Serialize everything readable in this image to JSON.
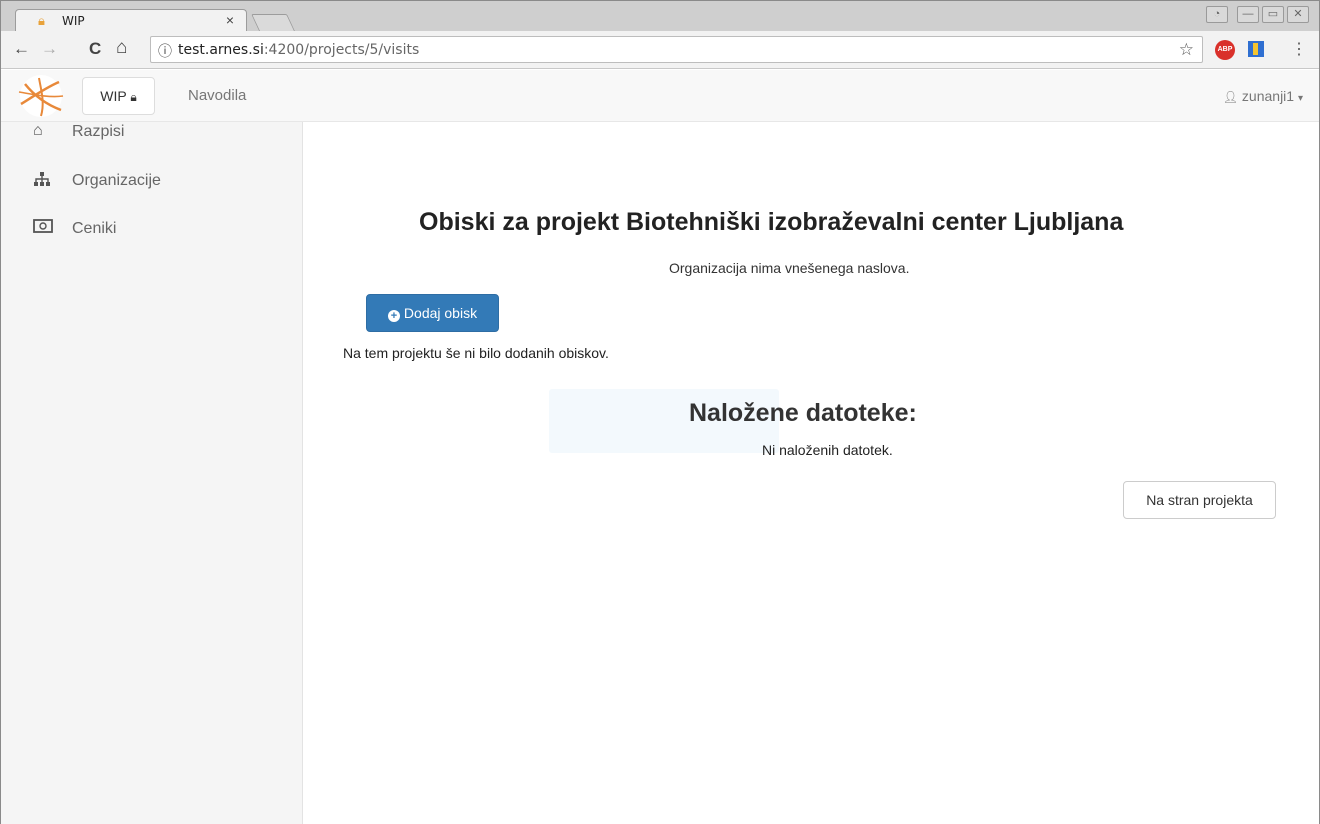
{
  "browser": {
    "tab_title": "WIP",
    "tab_close": "×",
    "url_host": "test.arnes.si",
    "url_path": ":4200/projects/5/visits",
    "info_glyph": "ⓘ",
    "back_glyph": "←",
    "forward_glyph": "→",
    "reload_glyph": "C",
    "home_glyph": "⌂",
    "star_glyph": "☆",
    "menu_glyph": "⋮",
    "abp_label": "ABP",
    "window_buttons": [
      "◔",
      "—",
      "▭",
      "✕"
    ]
  },
  "navbar": {
    "brand_label": "WIP",
    "brand_icon": "lock-icon",
    "link_label": "Navodila",
    "user_label": "zunanji1",
    "user_icon": "user-icon"
  },
  "sidebar": {
    "items": [
      {
        "label": "Razpisi",
        "icon": "home-icon"
      },
      {
        "label": "Organizacije",
        "icon": "sitemap-icon"
      },
      {
        "label": "Ceniki",
        "icon": "money-icon"
      }
    ]
  },
  "main": {
    "title": "Obiski za projekt Biotehniški izobraževalni center Ljubljana",
    "subtitle": "Organizacija nima vnešenega naslova.",
    "add_button_label": "Dodaj obisk",
    "empty_visits_text": "Na tem projektu še ni bilo dodanih obiskov.",
    "files_title": "Naložene datoteke:",
    "files_empty_text": "Ni naloženih datotek.",
    "back_button_label": "Na stran projekta"
  },
  "colors": {
    "primary": "#337ab7",
    "logo_accent": "#e8893a",
    "favicon": "#e8a23a"
  }
}
